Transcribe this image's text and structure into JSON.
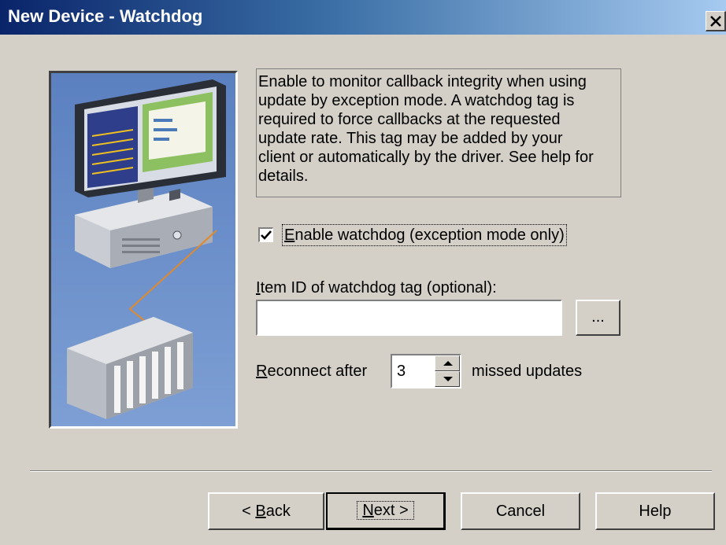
{
  "window": {
    "title": "New Device - Watchdog"
  },
  "description": "Enable to monitor callback integrity when using\nupdate by exception mode. A watchdog tag is\nrequired to force callbacks at the requested\nupdate rate. This tag may be added by your\nclient or automatically by the driver. See help for\ndetails.",
  "enable_watchdog": {
    "checked": true,
    "label_prefix": "E",
    "label_rest": "nable watchdog (exception mode only)"
  },
  "item_id": {
    "label_prefix": "I",
    "label_rest": "tem ID of watchdog tag (optional):",
    "value": "",
    "browse_label": "..."
  },
  "reconnect": {
    "label_prefix": "R",
    "label_rest": "econnect after",
    "value": "3",
    "suffix": "missed updates"
  },
  "buttons": {
    "back_pre": "< ",
    "back_mn": "B",
    "back_rest": "ack",
    "next_mn": "N",
    "next_rest": "ext >",
    "cancel": "Cancel",
    "help": "Help"
  },
  "icons": [
    "close-icon",
    "checkmark-icon",
    "spin-up-icon",
    "spin-down-icon",
    "computer-illustration",
    "plc-illustration"
  ],
  "colors": {
    "title_bar_start": "#0a246a",
    "title_bar_end": "#a6caf0",
    "dialog_bg": "#d4d0c8",
    "side_panel_bg": "#6a8ec9"
  }
}
